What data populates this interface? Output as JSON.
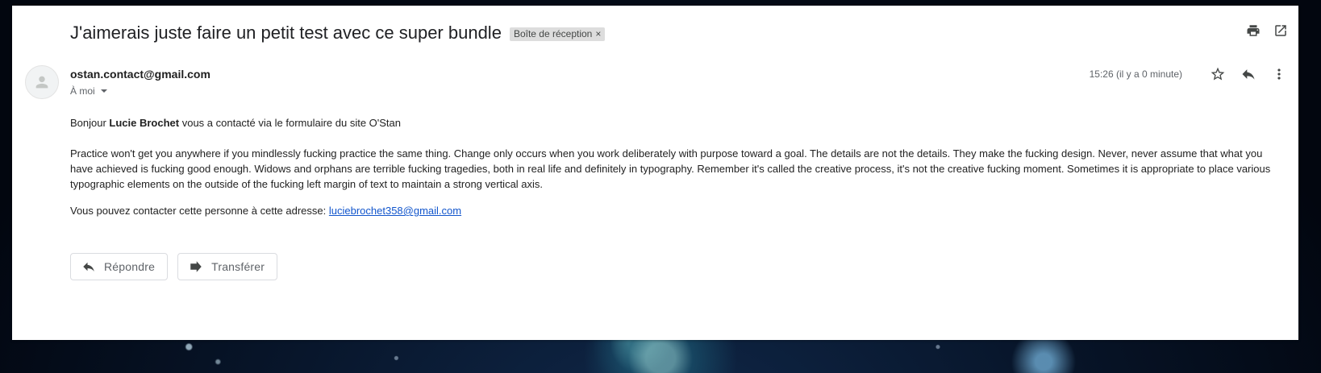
{
  "email": {
    "subject": "J'aimerais juste faire un petit test avec ce super bundle",
    "label": "Boîte de réception",
    "label_remove_glyph": "×",
    "sender": "ostan.contact@gmail.com",
    "recipient": "À moi",
    "timestamp": "15:26 (il y a 0 minute)",
    "body": {
      "greeting_before": "Bonjour ",
      "greeting_name": "Lucie Brochet",
      "greeting_after": " vous a contacté via le formulaire du site O'Stan",
      "message": "Practice won't get you anywhere if you mindlessly fucking practice the same thing. Change only occurs when you work deliberately with purpose toward a goal. The details are not the details. They make the fucking design. Never, never assume that what you have achieved is fucking good enough. Widows and orphans are terrible fucking tragedies, both in real life and definitely in typography. Remember it's called the creative process, it's not the creative fucking moment. Sometimes it is appropriate to place various typographic elements on the outside of the fucking left margin of text to maintain a strong vertical axis.",
      "contact_prefix": "Vous pouvez contacter cette personne à cette adresse: ",
      "contact_email": "luciebrochet358@gmail.com",
      "contact_href": "mailto:luciebrochet358@gmail.com"
    }
  },
  "actions": {
    "reply_label": "Répondre",
    "forward_label": "Transférer"
  },
  "icons": {
    "print": "print-icon",
    "open_new_window": "open-in-new-window-icon",
    "star": "star-icon",
    "reply": "reply-icon",
    "more": "more-vert-icon",
    "avatar": "person-icon",
    "forward": "forward-icon"
  },
  "colors": {
    "link": "#1155cc",
    "label_chip": "#dddddd",
    "text": "#202124",
    "muted": "#5f6368"
  }
}
